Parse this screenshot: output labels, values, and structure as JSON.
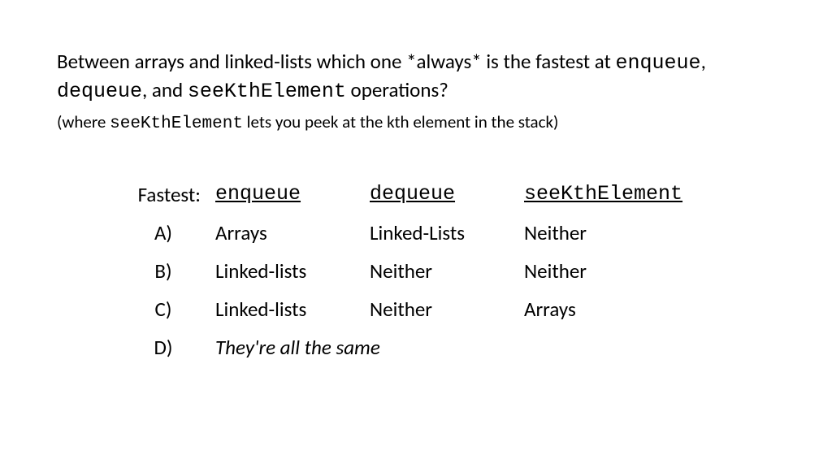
{
  "question": {
    "prefix": "Between arrays and linked-lists which one *always* is the fastest at ",
    "op1": "enqueue",
    "sep1": ", ",
    "op2": "dequeue",
    "sep2": ", and ",
    "op3": "seeKthElement",
    "suffix": " operations?"
  },
  "subtext": {
    "prefix": "(where ",
    "op": "seeKthElement",
    "suffix": " lets you peek at the kth element in the stack)"
  },
  "table": {
    "header_label": "Fastest:",
    "headers": {
      "enqueue": "enqueue",
      "dequeue": "dequeue",
      "seek": "seeKthElement"
    },
    "rows": [
      {
        "label": "A)",
        "enqueue": "Arrays",
        "dequeue": "Linked-Lists",
        "seek": "Neither"
      },
      {
        "label": "B)",
        "enqueue": "Linked-lists",
        "dequeue": "Neither",
        "seek": "Neither"
      },
      {
        "label": "C)",
        "enqueue": "Linked-lists",
        "dequeue": "Neither",
        "seek": "Arrays"
      },
      {
        "label": "D)",
        "span": "They're all the same"
      }
    ]
  }
}
